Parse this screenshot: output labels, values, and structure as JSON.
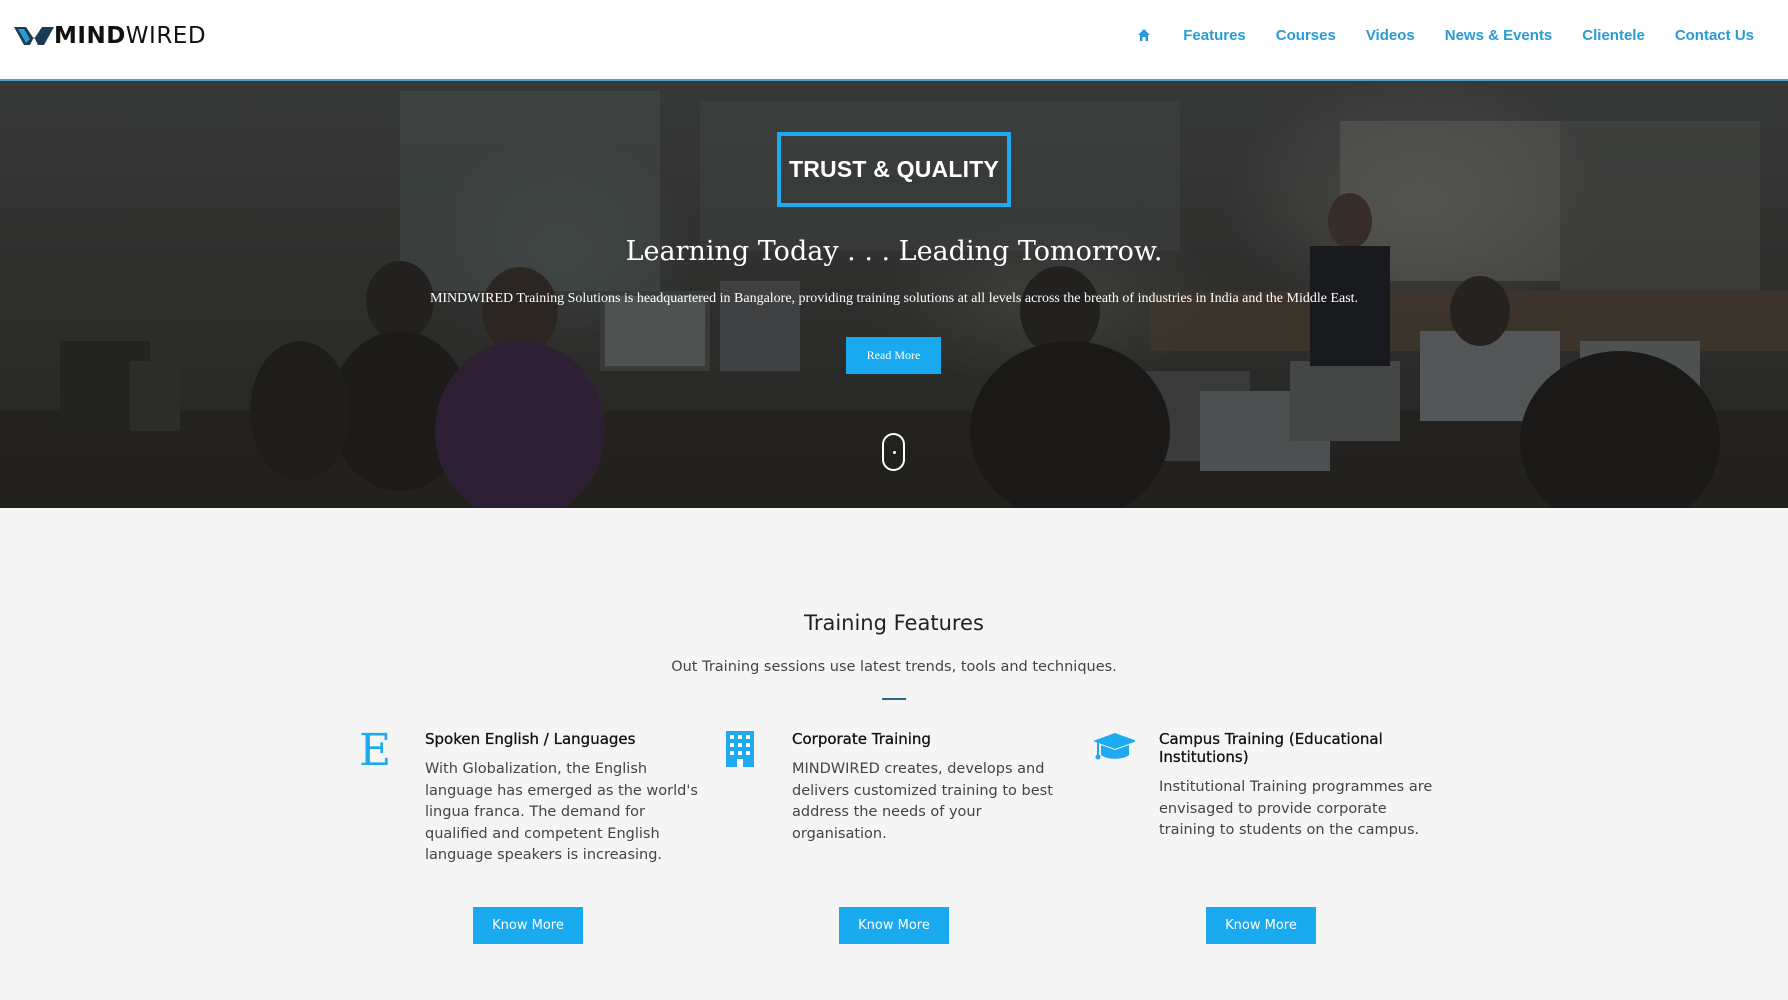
{
  "brand": {
    "name_bold": "MIND",
    "name_light": "WIRED"
  },
  "nav": {
    "home_icon": "home-icon",
    "items": [
      "Features",
      "Courses",
      "Videos",
      "News & Events",
      "Clientele",
      "Contact Us"
    ]
  },
  "hero": {
    "badge": "TRUST & QUALITY",
    "title": "Learning Today . . . Leading Tomorrow.",
    "description": "MINDWIRED Training Solutions is headquartered in Bangalore, providing training solutions at all levels across the breath of industries in India and the Middle East.",
    "button": "Read More",
    "scroll_icon": "mouse-scroll-icon"
  },
  "features": {
    "title": "Training Features",
    "subtitle": "Out Training sessions use latest trends, tools and techniques.",
    "items": [
      {
        "icon": "letter-e-icon",
        "title": "Spoken English / Languages",
        "text": "With Globalization, the English language has emerged as the world's lingua franca. The demand for qualified and competent English language speakers is increasing.",
        "button": "Know More"
      },
      {
        "icon": "building-icon",
        "title": "Corporate Training",
        "text": "MINDWIRED creates, develops and delivers customized training to best address the needs of your organisation.",
        "button": "Know More"
      },
      {
        "icon": "graduation-cap-icon",
        "title": "Campus Training (Educational Institutions)",
        "text": "Institutional Training programmes are envisaged to provide corporate training to students on the campus.",
        "button": "Know More"
      }
    ]
  },
  "colors": {
    "accent": "#18a9ef",
    "nav_link": "#2a9bd4",
    "badge_border": "#1daaf0"
  }
}
